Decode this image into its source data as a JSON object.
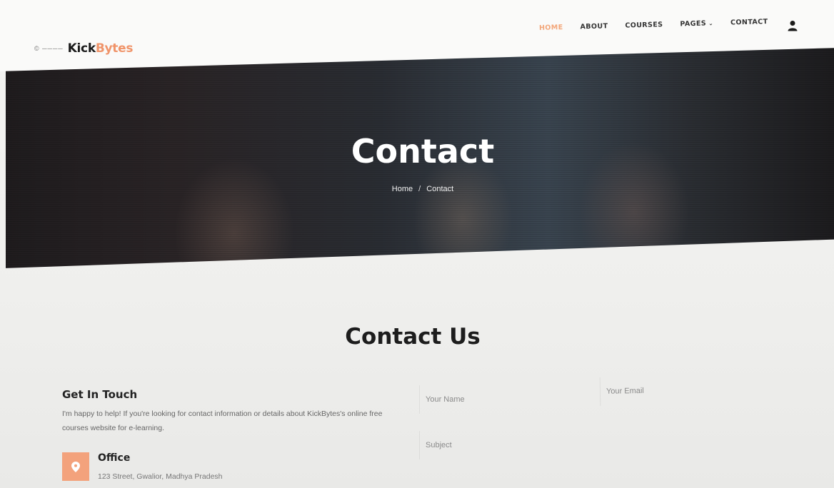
{
  "brand": {
    "mark": "© ──── ",
    "name_part1": "Kick",
    "name_part2": "Bytes",
    "accent_color": "#f0946a"
  },
  "nav": {
    "items": [
      {
        "label": "HOME",
        "active": true
      },
      {
        "label": "ABOUT",
        "active": false
      },
      {
        "label": "COURSES",
        "active": false
      },
      {
        "label": "PAGES",
        "active": false
      },
      {
        "label": "CONTACT",
        "active": false
      }
    ],
    "user_icon": "user-icon"
  },
  "hero": {
    "title": "Contact",
    "breadcrumb_home": "Home",
    "breadcrumb_sep": "/",
    "breadcrumb_current": "Contact"
  },
  "contact": {
    "title": "Contact Us",
    "get_in_touch": "Get In Touch",
    "description": "I'm happy to help! If you're looking for contact information or details about KickBytes's online free courses website for e-learning.",
    "office_title": "Office",
    "office_address": "123 Street, Gwalior, Madhya Pradesh",
    "office_icon": "location-pin-icon",
    "office_icon_color": "#f3a27c"
  },
  "form": {
    "name_placeholder": "Your Name",
    "email_placeholder": "Your Email",
    "subject_placeholder": "Subject"
  }
}
